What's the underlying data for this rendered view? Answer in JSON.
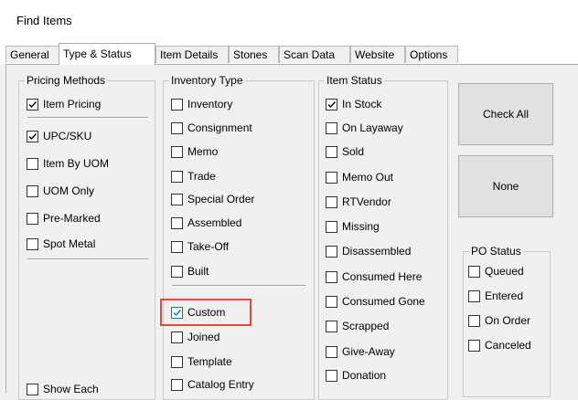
{
  "window": {
    "title": "Find Items"
  },
  "tabs": [
    {
      "label": "General"
    },
    {
      "label": "Type & Status"
    },
    {
      "label": "Item Details"
    },
    {
      "label": "Stones"
    },
    {
      "label": "Scan Data"
    },
    {
      "label": "Website"
    },
    {
      "label": "Options"
    }
  ],
  "active_tab": "Type & Status",
  "pricing_methods": {
    "label": "Pricing Methods",
    "items": [
      {
        "label": "Item Pricing",
        "checked": true
      },
      {
        "label": "UPC/SKU",
        "checked": true
      },
      {
        "label": "Item By UOM",
        "checked": false
      },
      {
        "label": "UOM Only",
        "checked": false
      },
      {
        "label": "Pre-Marked",
        "checked": false
      },
      {
        "label": "Spot Metal",
        "checked": false
      }
    ],
    "show_each": {
      "label": "Show Each",
      "checked": false
    }
  },
  "inventory_type": {
    "label": "Inventory Type",
    "items": [
      {
        "label": "Inventory",
        "checked": false
      },
      {
        "label": "Consignment",
        "checked": false
      },
      {
        "label": "Memo",
        "checked": false
      },
      {
        "label": "Trade",
        "checked": false
      },
      {
        "label": "Special Order",
        "checked": false
      },
      {
        "label": "Assembled",
        "checked": false
      },
      {
        "label": "Take-Off",
        "checked": false
      },
      {
        "label": "Built",
        "checked": false
      },
      {
        "label": "Custom",
        "checked": true
      },
      {
        "label": "Joined",
        "checked": false
      },
      {
        "label": "Template",
        "checked": false
      },
      {
        "label": "Catalog Entry",
        "checked": false
      }
    ]
  },
  "item_status": {
    "label": "Item Status",
    "items": [
      {
        "label": "In Stock",
        "checked": true
      },
      {
        "label": "On Layaway",
        "checked": false
      },
      {
        "label": "Sold",
        "checked": false
      },
      {
        "label": "Memo Out",
        "checked": false
      },
      {
        "label": "RTVendor",
        "checked": false
      },
      {
        "label": "Missing",
        "checked": false
      },
      {
        "label": "Disassembled",
        "checked": false
      },
      {
        "label": "Consumed Here",
        "checked": false
      },
      {
        "label": "Consumed Gone",
        "checked": false
      },
      {
        "label": "Scrapped",
        "checked": false
      },
      {
        "label": "Give-Away",
        "checked": false
      },
      {
        "label": "Donation",
        "checked": false
      }
    ]
  },
  "po_status": {
    "label": "PO Status",
    "items": [
      {
        "label": "Queued",
        "checked": false
      },
      {
        "label": "Entered",
        "checked": false
      },
      {
        "label": "On Order",
        "checked": false
      },
      {
        "label": "Canceled",
        "checked": false
      }
    ]
  },
  "buttons": {
    "check_all": "Check All",
    "none": "None"
  },
  "colors": {
    "highlight": "#e8453c",
    "focus_blue": "#0078d7",
    "panel": "#f0f0f0"
  }
}
